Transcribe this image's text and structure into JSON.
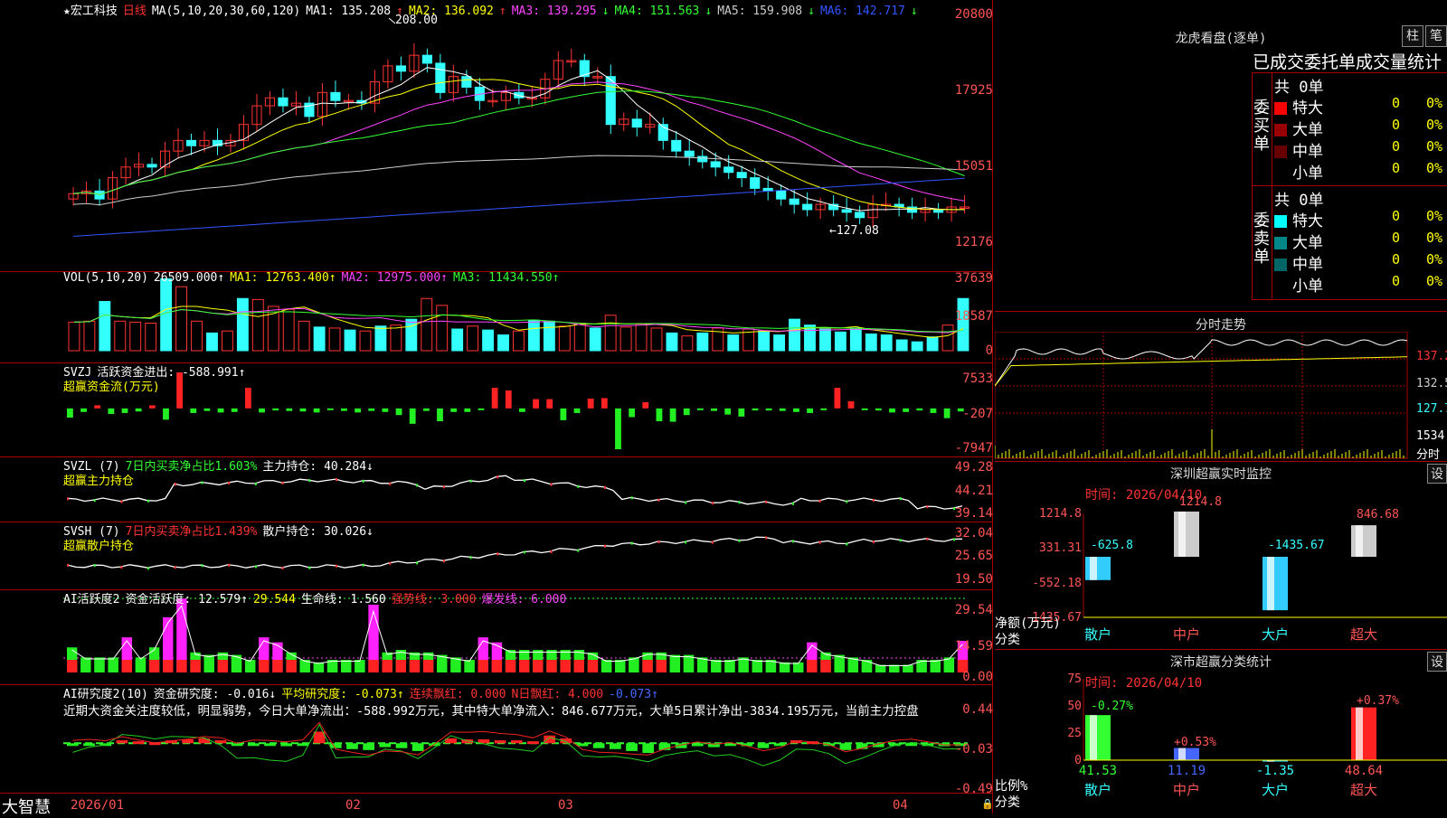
{
  "stock": {
    "name": "★宏工科技",
    "period": "日线",
    "ma_spec": "MA(5,10,20,30,60,120)",
    "ma": [
      {
        "label": "MA1: 135.208",
        "arrow": "↑",
        "color": "#ffffff"
      },
      {
        "label": "MA2: 136.092",
        "arrow": "↑",
        "color": "#ffff00"
      },
      {
        "label": "MA3: 139.295",
        "arrow": "↓",
        "color": "#ff44ff"
      },
      {
        "label": "MA4: 151.563",
        "arrow": "↓",
        "color": "#33ff33"
      },
      {
        "label": "MA5: 159.908",
        "arrow": "↓",
        "color": "#cccccc"
      },
      {
        "label": "MA6: 142.717",
        "arrow": "↓",
        "color": "#3355ff"
      }
    ],
    "price_axis": [
      "20800",
      "17925",
      "15051",
      "12176"
    ],
    "high_mark": "208.00",
    "low_mark": "←127.08"
  },
  "vol": {
    "title": "VOL(5,10,20)",
    "v": "26509.000↑",
    "ma1": "MA1: 12763.400↑",
    "ma2": "MA2: 12975.000↑",
    "ma3": "MA3: 11434.550↑",
    "axis": [
      "37639",
      "18587",
      "0"
    ]
  },
  "svzj": {
    "title": "SVZJ",
    "text": "活跃资金进出: -588.991↑",
    "sub": "超赢资金流(万元)",
    "axis": [
      "7533",
      "-207",
      "-7947"
    ]
  },
  "svzl": {
    "title": "SVZL (7)",
    "t2": "7日内买卖净占比1.603%",
    "t3": "主力持仓: 40.284↓",
    "sub": "超赢主力持仓",
    "axis": [
      "49.28",
      "44.21",
      "39.14"
    ]
  },
  "svsh": {
    "title": "SVSH (7)",
    "t2": "7日内买卖净占比1.439%",
    "t3": "散户持仓: 30.026↓",
    "sub": "超赢散户持仓",
    "axis": [
      "32.04",
      "25.65",
      "19.50"
    ]
  },
  "ai1": {
    "title": "AI活跃度2",
    "t1": "资金活跃度: 12.579↑",
    "t2": "29.544",
    "t3": "生命线: 1.560",
    "t4": "强势线: 3.000",
    "t5": "爆发线: 6.000",
    "axis": [
      "29.54",
      "14.59",
      "0.00"
    ]
  },
  "ai2": {
    "title": "AI研究度2(10)",
    "t1": "资金研究度: -0.016↓",
    "t2": "平均研究度: -0.073↑",
    "t3": "连续飘红: 0.000",
    "t4": "N日飘红: 4.000",
    "t5": "-0.073↑",
    "note": "近期大资金关注度较低，明显弱势，今日大单净流出：-588.992万元，其中特大单净流入：846.677万元，大单5日累计净出-3834.195万元，当前主力控盘",
    "axis": [
      "0.44",
      "-0.03",
      "-0.49"
    ]
  },
  "xaxis": {
    "logo": "大智慧",
    "labels": [
      "2026/01",
      "02",
      "03",
      "04"
    ]
  },
  "dragon": {
    "title": "龙虎看盘(逐单)",
    "btn1": "柱",
    "btn2": "笔",
    "head": "已成交委托单成交量统计",
    "buy": {
      "label": "委买单",
      "total": "共 0单",
      "rows": [
        {
          "name": "特大",
          "v": "0",
          "p": "0%",
          "color": "#ff0000"
        },
        {
          "name": "大单",
          "v": "0",
          "p": "0%",
          "color": "#990000"
        },
        {
          "name": "中单",
          "v": "0",
          "p": "0%",
          "color": "#660000"
        },
        {
          "name": "小单",
          "v": "0",
          "p": "0%",
          "color": "#000000"
        }
      ]
    },
    "sell": {
      "label": "委卖单",
      "total": "共 0单",
      "rows": [
        {
          "name": "特大",
          "v": "0",
          "p": "0%",
          "color": "#00ffff"
        },
        {
          "name": "大单",
          "v": "0",
          "p": "0%",
          "color": "#008888"
        },
        {
          "name": "中单",
          "v": "0",
          "p": "0%",
          "color": "#006666"
        },
        {
          "name": "小单",
          "v": "0",
          "p": "0%",
          "color": "#000000"
        }
      ]
    }
  },
  "fenshi": {
    "title": "分时走势",
    "axis": [
      "137.2",
      "132.5",
      "127.7",
      "1534",
      "分时"
    ]
  },
  "monitor": {
    "title": "深圳超赢实时监控",
    "btn": "设",
    "time": "时间: 2026/04/10",
    "axis": [
      "1214.8",
      "331.31",
      "-552.18",
      "-1435.67"
    ],
    "unit": "净额(万元)",
    "cat_label": "分类",
    "cats": [
      "散户",
      "中户",
      "大户",
      "超大"
    ]
  },
  "classify": {
    "title": "深市超赢分类统计",
    "btn": "设",
    "time": "时间: 2026/04/10",
    "axis": [
      "75",
      "50",
      "25",
      "0"
    ],
    "unit": "比例%",
    "cat_label": "分类",
    "cats": [
      "散户",
      "中户",
      "大户",
      "超大"
    ],
    "bottom": [
      "41.53",
      "11.19",
      "-1.35",
      "48.64"
    ]
  },
  "chart_data": [
    {
      "type": "candlestick",
      "title": "宏工科技 日线",
      "x_range": [
        "2026/01",
        "2026/04/10"
      ],
      "ylim": [
        121.76,
        208.0
      ],
      "high": 208.0,
      "low": 127.08,
      "close": [
        140,
        141,
        138,
        146,
        150,
        151,
        150,
        156,
        160,
        158,
        160,
        158,
        160,
        166,
        173,
        176,
        173,
        174,
        169,
        178,
        175,
        175,
        174,
        182,
        188,
        186,
        192,
        189,
        178,
        184,
        180,
        175,
        175,
        178,
        176,
        176,
        183,
        190,
        190,
        184,
        184,
        166,
        168,
        165,
        166,
        160,
        156,
        154,
        152,
        150,
        148,
        146,
        142,
        141,
        138,
        136,
        134,
        136,
        134,
        133,
        131,
        136,
        136,
        135,
        133,
        134,
        133,
        135,
        135
      ]
    },
    {
      "type": "bar",
      "title": "VOL(5,10,20)",
      "ylim": [
        0,
        37639
      ],
      "values": [
        14500,
        15000,
        25000,
        15000,
        14500,
        14000,
        36500,
        32500,
        15000,
        9000,
        10000,
        26500,
        26000,
        22500,
        21000,
        15000,
        12000,
        11500,
        10500,
        10000,
        12500,
        13000,
        16000,
        26500,
        23000,
        11000,
        12500,
        10500,
        8000,
        10000,
        15500,
        15000,
        12500,
        14000,
        11500,
        18000,
        12000,
        13500,
        11500,
        9000,
        7500,
        9000,
        11500,
        8000,
        11000,
        10000,
        8000,
        16000,
        13000,
        11000,
        9500,
        11500,
        8500,
        8000,
        5500,
        4500,
        7000,
        13000,
        26509
      ],
      "ma": [
        {
          "name": "MA1",
          "last": 12763.4
        },
        {
          "name": "MA2",
          "last": 12975.0
        },
        {
          "name": "MA3",
          "last": 11434.55
        }
      ]
    },
    {
      "type": "bar",
      "title": "超赢资金流(万元)",
      "ylim": [
        -7947,
        7533
      ],
      "values": [
        -1800,
        -700,
        600,
        -1100,
        -900,
        -600,
        600,
        -2200,
        7000,
        -900,
        -500,
        -800,
        -700,
        4000,
        -800,
        -400,
        -500,
        -600,
        -800,
        -300,
        -500,
        -800,
        -500,
        -700,
        -1300,
        -3000,
        -500,
        -2500,
        -700,
        -700,
        -100,
        4000,
        3500,
        -700,
        1800,
        1800,
        -2300,
        -900,
        1900,
        2000,
        -7947,
        -1700,
        1200,
        -2500,
        -2600,
        -1300,
        -300,
        -500,
        -1200,
        -1600,
        -400,
        -400,
        -500,
        -700,
        -900,
        -200,
        4000,
        1400,
        -300,
        -400,
        -800,
        -700,
        -400,
        -900,
        -1900,
        -589
      ],
      "last": -588.991
    },
    {
      "type": "line",
      "title": "超赢主力持仓",
      "ylim": [
        39.14,
        49.28
      ],
      "last": 40.284
    },
    {
      "type": "line",
      "title": "超赢散户持仓",
      "ylim": [
        19.5,
        32.04
      ],
      "last": 30.026
    },
    {
      "type": "bar",
      "title": "AI活跃度2",
      "ylim": [
        0,
        29.54
      ],
      "values": [
        10,
        6,
        6,
        6,
        14,
        6,
        10,
        22,
        29.5,
        8,
        7,
        8,
        7,
        5,
        14,
        12,
        8,
        5,
        4,
        5,
        5,
        5,
        27,
        8,
        9,
        8,
        8,
        7,
        6,
        5,
        14,
        12,
        9,
        9,
        9,
        9,
        9,
        9,
        8,
        5,
        5,
        6,
        8,
        8,
        7,
        7,
        6,
        5,
        5,
        6,
        5,
        5,
        4,
        4,
        12,
        8,
        7,
        6,
        5,
        3,
        3,
        3,
        5,
        5,
        6,
        12.579
      ],
      "lines": {
        "生命线": 1.56,
        "强势线": 3.0,
        "爆发线": 6.0
      }
    },
    {
      "type": "bar",
      "title": "AI研究度2(10)",
      "ylim": [
        -0.49,
        0.44
      ],
      "values": [
        -0.02,
        -0.01,
        -0.01,
        0.03,
        0.02,
        0.01,
        0.03,
        0.04,
        0.05,
        0.03,
        -0.02,
        -0.01,
        -0.02,
        -0.03,
        -0.01,
        0.12,
        -0.05,
        -0.06,
        -0.07,
        -0.04,
        -0.05,
        -0.08,
        -0.02,
        0.05,
        0.04,
        0.04,
        0.03,
        0.03,
        0.02,
        0.08,
        0.05,
        -0.03,
        -0.05,
        -0.06,
        -0.08,
        -0.1,
        -0.07,
        -0.05,
        -0.03,
        -0.04,
        -0.02,
        -0.03,
        -0.05,
        -0.02,
        0.03,
        0.02,
        -0.01,
        -0.07,
        -0.06,
        -0.04,
        -0.02,
        -0.01,
        -0.02,
        -0.03,
        -0.016
      ],
      "last": -0.016
    },
    {
      "type": "bar",
      "title": "深圳超赢实时监控",
      "categories": [
        "散户",
        "中户",
        "大户",
        "超大"
      ],
      "values": [
        -625.8,
        1214.8,
        -1435.67,
        846.68
      ],
      "ylim": [
        -1435.67,
        1214.8
      ]
    },
    {
      "type": "bar",
      "title": "深市超赢分类统计",
      "categories": [
        "散户",
        "中户",
        "大户",
        "超大"
      ],
      "values": [
        41.53,
        11.19,
        -1.35,
        48.64
      ],
      "change": [
        "-0.27%",
        "+0.53%",
        "",
        "+0.37%"
      ],
      "ylim": [
        0,
        75
      ]
    }
  ]
}
